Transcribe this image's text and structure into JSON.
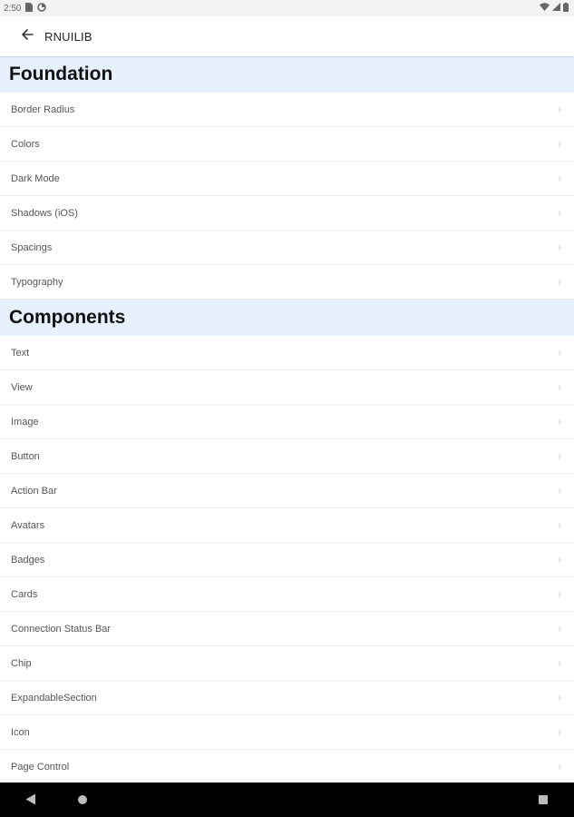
{
  "status_bar": {
    "time": "2:50",
    "icons": [
      "sim-icon",
      "data-saver-icon",
      "wifi-icon",
      "signal-icon",
      "battery-icon"
    ]
  },
  "app_bar": {
    "title": "RNUILIB",
    "back_icon": "arrow-left-icon"
  },
  "sections": [
    {
      "title": "Foundation",
      "items": [
        "Border Radius",
        "Colors",
        "Dark Mode",
        "Shadows (iOS)",
        "Spacings",
        "Typography"
      ]
    },
    {
      "title": "Components",
      "items": [
        "Text",
        "View",
        "Image",
        "Button",
        "Action Bar",
        "Avatars",
        "Badges",
        "Cards",
        "Connection Status Bar",
        "Chip",
        "ExpandableSection",
        "Icon",
        "Page Control"
      ]
    }
  ],
  "nav_bar": {
    "icons": [
      "back-triangle-icon",
      "home-circle-icon",
      "recents-square-icon"
    ]
  },
  "colors": {
    "section_header_bg": "#e6f1fd",
    "row_divider": "#eeeeee",
    "nav_bar_bg": "#000000"
  }
}
